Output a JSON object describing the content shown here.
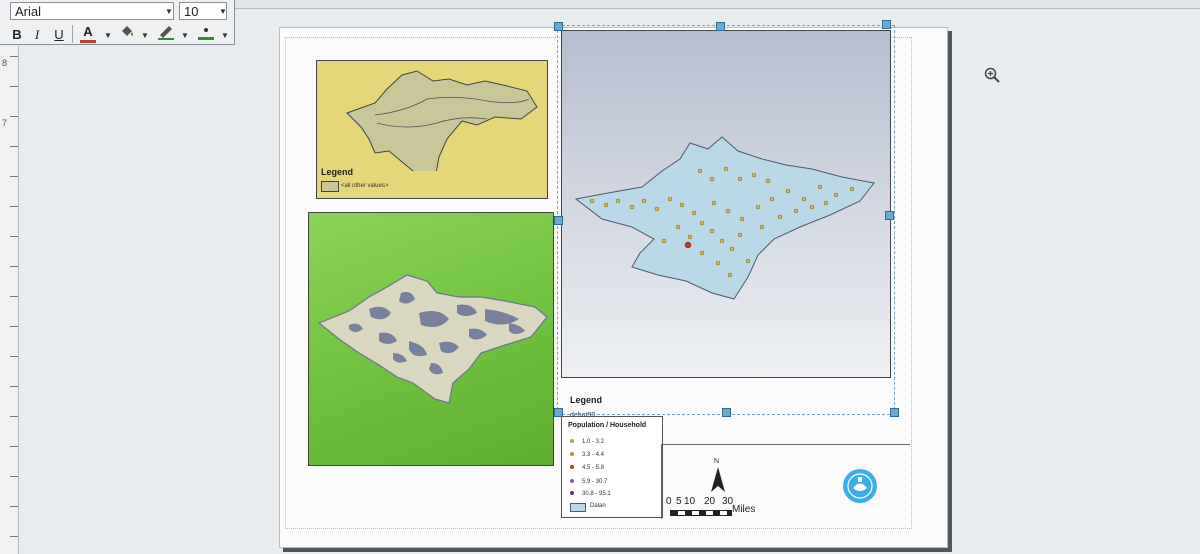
{
  "toolbar": {
    "font_name": "Arial",
    "font_size": "10",
    "bold_label": "B",
    "italic_label": "I",
    "underline_label": "U",
    "font_color_label": "A",
    "font_color": "#c0392b",
    "fill_color": "#2f8f2f"
  },
  "ruler": {
    "left_numbers": [
      "8",
      "7"
    ]
  },
  "icons": {
    "zoom": "zoom-in-icon",
    "north": "north-arrow-icon",
    "logo": "university-seal-icon"
  },
  "map_yellow": {
    "legend_title": "Legend",
    "legend_item": "<all other values>",
    "bg_color": "#e6d67a"
  },
  "map_green": {
    "bg_color": "#7ac84a"
  },
  "map_blue": {
    "legend_title": "Legend",
    "legend_layer": "dehat90",
    "legend_field": "Population / Household",
    "classes": [
      {
        "label": "1.0 - 3.2",
        "color": "#b9a343"
      },
      {
        "label": "3.3 - 4.4",
        "color": "#c28a2e"
      },
      {
        "label": "4.5 - 5.8",
        "color": "#c0392b"
      },
      {
        "label": "5.9 - 30.7",
        "color": "#8e5aa0"
      },
      {
        "label": "30.8 - 95.1",
        "color": "#5b3a7a"
      }
    ],
    "area_label": "Dalan",
    "area_color": "#b8d8e8"
  },
  "scale_bar": {
    "ticks": [
      "0",
      "5",
      "10",
      "20",
      "30"
    ],
    "unit": "Miles",
    "north_label": "N"
  }
}
